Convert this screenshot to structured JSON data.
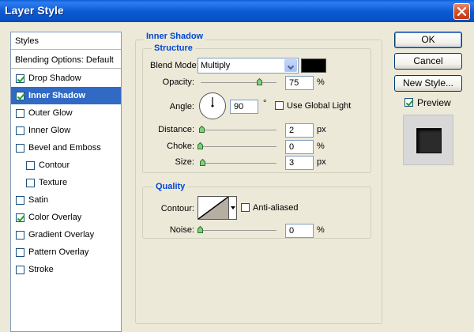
{
  "window": {
    "title": "Layer Style"
  },
  "styles_list": {
    "header": "Styles",
    "items": [
      {
        "label": "Blending Options: Default",
        "has_checkbox": false,
        "checked": false,
        "selected": false,
        "indent": false
      },
      {
        "label": "Drop Shadow",
        "has_checkbox": true,
        "checked": true,
        "selected": false,
        "indent": false
      },
      {
        "label": "Inner Shadow",
        "has_checkbox": true,
        "checked": true,
        "selected": true,
        "indent": false
      },
      {
        "label": "Outer Glow",
        "has_checkbox": true,
        "checked": false,
        "selected": false,
        "indent": false
      },
      {
        "label": "Inner Glow",
        "has_checkbox": true,
        "checked": false,
        "selected": false,
        "indent": false
      },
      {
        "label": "Bevel and Emboss",
        "has_checkbox": true,
        "checked": false,
        "selected": false,
        "indent": false
      },
      {
        "label": "Contour",
        "has_checkbox": true,
        "checked": false,
        "selected": false,
        "indent": true
      },
      {
        "label": "Texture",
        "has_checkbox": true,
        "checked": false,
        "selected": false,
        "indent": true
      },
      {
        "label": "Satin",
        "has_checkbox": true,
        "checked": false,
        "selected": false,
        "indent": false
      },
      {
        "label": "Color Overlay",
        "has_checkbox": true,
        "checked": true,
        "selected": false,
        "indent": false
      },
      {
        "label": "Gradient Overlay",
        "has_checkbox": true,
        "checked": false,
        "selected": false,
        "indent": false
      },
      {
        "label": "Pattern Overlay",
        "has_checkbox": true,
        "checked": false,
        "selected": false,
        "indent": false
      },
      {
        "label": "Stroke",
        "has_checkbox": true,
        "checked": false,
        "selected": false,
        "indent": false
      }
    ]
  },
  "inner_shadow": {
    "title": "Inner Shadow",
    "structure": {
      "title": "Structure",
      "blend_mode_label": "Blend Mode:",
      "blend_mode_value": "Multiply",
      "shadow_color": "#000000",
      "opacity_label": "Opacity:",
      "opacity_value": "75",
      "opacity_unit": "%",
      "opacity_fraction": 0.75,
      "angle_label": "Angle:",
      "angle_value": "90",
      "angle_unit": "°",
      "use_global_light_label": "Use Global Light",
      "use_global_light_checked": false,
      "distance_label": "Distance:",
      "distance_value": "2",
      "distance_unit": "px",
      "choke_label": "Choke:",
      "choke_value": "0",
      "choke_unit": "%",
      "size_label": "Size:",
      "size_value": "3",
      "size_unit": "px"
    },
    "quality": {
      "title": "Quality",
      "contour_label": "Contour:",
      "anti_aliased_label": "Anti-aliased",
      "anti_aliased_checked": false,
      "noise_label": "Noise:",
      "noise_value": "0",
      "noise_unit": "%"
    }
  },
  "buttons": {
    "ok_label": "OK",
    "cancel_label": "Cancel",
    "new_style_label": "New Style...",
    "preview_label": "Preview",
    "preview_checked": true
  },
  "colors": {
    "titlebar": "#0a58d0",
    "selection": "#316ac5",
    "group_title": "#0046d5",
    "dialog_bg": "#ece9d8"
  }
}
